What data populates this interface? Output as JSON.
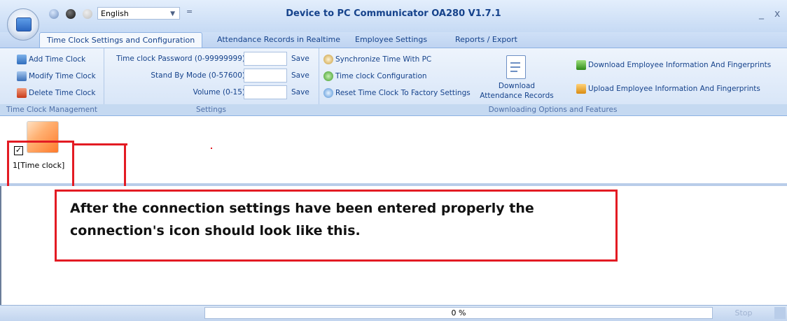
{
  "window": {
    "title": "Device to PC Communicator OA280 V1.7.1",
    "minimize_glyph": "_",
    "close_glyph": "x"
  },
  "quick_access": {
    "language": "English",
    "separator_glyph": "="
  },
  "tabs": [
    {
      "label": "Time Clock Settings and Configuration",
      "active": true
    },
    {
      "label": "Attendance Records in Realtime",
      "active": false
    },
    {
      "label": "Employee Settings",
      "active": false
    },
    {
      "label": "Reports / Export",
      "active": false
    }
  ],
  "ribbon": {
    "management": {
      "label": "Time Clock Management",
      "buttons": [
        "Add Time Clock",
        "Modify Time Clock",
        "Delete Time Clock"
      ]
    },
    "settings": {
      "label": "Settings",
      "rows": [
        {
          "label": "Time clock Password (0-99999999)",
          "value": "",
          "save": "Save"
        },
        {
          "label": "Stand By Mode (0-57600)",
          "value": "",
          "save": "Save"
        },
        {
          "label": "Volume (0-15)",
          "value": "",
          "save": "Save"
        }
      ]
    },
    "downloading": {
      "label": "Downloading Options and Features",
      "actions": [
        "Synchronize Time With PC",
        "Time clock Configuration",
        "Reset Time Clock To Factory Settings"
      ],
      "download_records_line1": "Download",
      "download_records_line2": "Attendance Records",
      "download_employee": "Download Employee Information And Fingerprints",
      "upload_employee": "Upload Employee Information And Fingerprints"
    }
  },
  "devices": [
    {
      "label": "1[Time clock]",
      "checked": true
    }
  ],
  "callout": {
    "text": "After the connection settings have been entered properly the connection's icon should look like this."
  },
  "status": {
    "progress_text": "0 %",
    "stop_label": "Stop"
  },
  "colors": {
    "highlight": "#e31b23",
    "ribbon_text": "#15428b",
    "device_icon": "#ff7a2b"
  }
}
